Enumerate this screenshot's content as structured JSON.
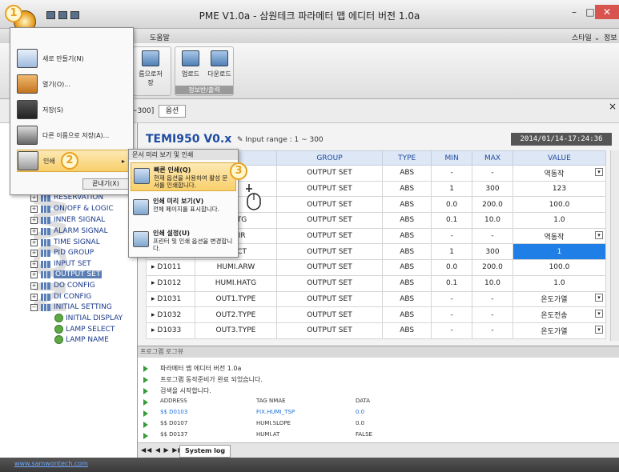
{
  "window": {
    "title": "PME V1.0a - 삼원테크 파라메터 맵 에디터 버전 1.0a",
    "minimize": "–",
    "maximize": "□",
    "close": "✕"
  },
  "menubar": {
    "help": "도움말",
    "style": "스타일 ⌄",
    "info": "정보"
  },
  "ribbon": {
    "save_as_label": "름으로저장",
    "upload_label": "업로드",
    "download_label": "다운로드",
    "group_label": "정보반/출력"
  },
  "input_row": {
    "range_text": "~300]",
    "option_button": "옵션"
  },
  "table": {
    "title": "TEMI950 V0.x",
    "input_range": "Input range : 1 ~ 300",
    "datetime": "2014/01/14-17:24:36",
    "headers": [
      "",
      "G",
      "GROUP",
      "TYPE",
      "MIN",
      "MAX",
      "VALUE"
    ],
    "rows": [
      {
        "address": "",
        "tag": "R",
        "group": "OUTPUT SET",
        "type": "ABS",
        "min": "-",
        "max": "-",
        "value": "역동작",
        "dropdown": true
      },
      {
        "address": "",
        "tag": "",
        "group": "OUTPUT SET",
        "type": "ABS",
        "min": "1",
        "max": "300",
        "value": "123",
        "dropdown": false
      },
      {
        "address": "",
        "tag": "A",
        "group": "OUTPUT SET",
        "type": "ABS",
        "min": "0.0",
        "max": "200.0",
        "value": "100.0",
        "dropdown": false
      },
      {
        "address": "",
        "tag": ".HATG",
        "group": "OUTPUT SET",
        "type": "ABS",
        "min": "0.1",
        "max": "10.0",
        "value": "1.0",
        "dropdown": false
      },
      {
        "address": "",
        "tag": "1.DIR",
        "group": "OUTPUT SET",
        "type": "ABS",
        "min": "-",
        "max": "-",
        "value": "역동작",
        "dropdown": true
      },
      {
        "address": "",
        "tag": "1.HCT",
        "group": "OUTPUT SET",
        "type": "ABS",
        "min": "1",
        "max": "300",
        "value": "1",
        "dropdown": false,
        "selected": true
      },
      {
        "address": "D1011",
        "tag": "HUMI.ARW",
        "group": "OUTPUT SET",
        "type": "ABS",
        "min": "0.0",
        "max": "200.0",
        "value": "100.0",
        "dropdown": false
      },
      {
        "address": "D1012",
        "tag": "HUMI.HATG",
        "group": "OUTPUT SET",
        "type": "ABS",
        "min": "0.1",
        "max": "10.0",
        "value": "1.0",
        "dropdown": false
      },
      {
        "address": "D1031",
        "tag": "OUT1.TYPE",
        "group": "OUTPUT SET",
        "type": "ABS",
        "min": "-",
        "max": "-",
        "value": "온도가열",
        "dropdown": true
      },
      {
        "address": "D1032",
        "tag": "OUT2.TYPE",
        "group": "OUTPUT SET",
        "type": "ABS",
        "min": "-",
        "max": "-",
        "value": "온도전송",
        "dropdown": true
      },
      {
        "address": "D1033",
        "tag": "OUT3.TYPE",
        "group": "OUTPUT SET",
        "type": "ABS",
        "min": "-",
        "max": "-",
        "value": "온도가열",
        "dropdown": true
      }
    ]
  },
  "tree": {
    "groups": [
      "RESERVATION",
      "ON/OFF & LOGIC",
      "INNER SIGNAL",
      "ALARM SIGNAL",
      "TIME SIGNAL",
      "PID GROUP",
      "INPUT SET",
      "OUTPUT SET",
      "DO CONFIG",
      "DI CONFIG",
      "INITIAL SETTING"
    ],
    "subitems": [
      "INITIAL DISPLAY",
      "LAMP SELECT",
      "LAMP NAME"
    ],
    "watermark": "NOW"
  },
  "app_menu": {
    "items": [
      "새로 만들기(N)",
      "열기(O)...",
      "저장(S)",
      "다른 이름으로 저장(A)...",
      "인쇄"
    ],
    "close_button": "끝내기(X)"
  },
  "print_submenu": {
    "header": "문서 미리 보기 및 인쇄",
    "items": [
      {
        "title": "빠른 인쇄(Q)",
        "desc": "현재 옵션을 사용하여 활성 문서를 인쇄합니다."
      },
      {
        "title": "인쇄 미리 보기(V)",
        "desc": "전체 페이지를 표시합니다."
      },
      {
        "title": "인쇄 설정(U)",
        "desc": "프린터 및 인쇄 옵션을 변경합니다."
      }
    ]
  },
  "badges": [
    "1",
    "2",
    "3"
  ],
  "log": {
    "header": "프로그램 로그뷰",
    "lines": [
      "파라메터 맵 에디터 버전 1.0a",
      "프로그램 동작준비가 완료 되었습니다.",
      "검색을 시작합니다."
    ],
    "columns": [
      "ADDRESS",
      "TAG NMAE",
      "DATA"
    ],
    "rows": [
      {
        "address": "$$ D0103",
        "tag": "FIX.HUMI_TSP",
        "data": "0.0",
        "highlight": true
      },
      {
        "address": "$$ D0107",
        "tag": "HUMI.SLOPE",
        "data": "0.0",
        "highlight": false
      },
      {
        "address": "$$ D0137",
        "tag": "HUMI.AT",
        "data": "FALSE",
        "highlight": false
      }
    ],
    "tab": "System log"
  },
  "status": {
    "url": "www.samwontech.com"
  },
  "colors": {
    "accent": "#1e4ba0",
    "selected_cell": "#1f7fe6",
    "highlight_orange": "#e8a020"
  }
}
